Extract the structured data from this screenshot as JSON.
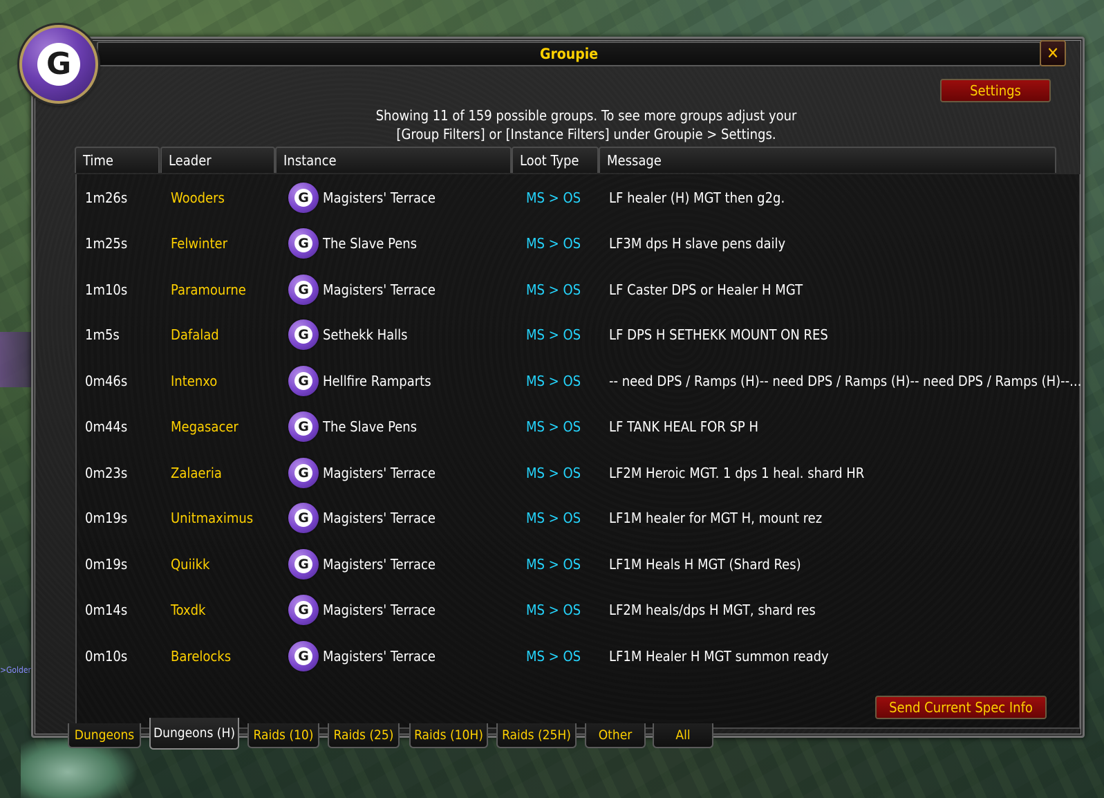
{
  "window": {
    "title": "Groupie",
    "close_glyph": "✕"
  },
  "logo": {
    "letter": "G",
    "icon": "groupie-logo-icon"
  },
  "info": {
    "line1": "Showing 11 of 159 possible groups. To see more groups adjust your",
    "line2": "[Group Filters] or [Instance Filters] under Groupie > Settings."
  },
  "settings_label": "Settings",
  "columns": [
    "Time",
    "Leader",
    "Instance",
    "Loot Type",
    "Message"
  ],
  "rows": [
    {
      "time": "1m26s",
      "leader": "Wooders",
      "instance": "Magisters' Terrace",
      "loot": "MS > OS",
      "message": "LF healer (H) MGT then g2g."
    },
    {
      "time": "1m25s",
      "leader": "Felwinter",
      "instance": "The Slave Pens",
      "loot": "MS > OS",
      "message": "LF3M dps H slave pens daily"
    },
    {
      "time": "1m10s",
      "leader": "Paramourne",
      "instance": "Magisters' Terrace",
      "loot": "MS > OS",
      "message": "LF Caster DPS or Healer H MGT"
    },
    {
      "time": "1m5s",
      "leader": "Dafalad",
      "instance": "Sethekk Halls",
      "loot": "MS > OS",
      "message": "LF DPS H SETHEKK MOUNT ON RES"
    },
    {
      "time": "0m46s",
      "leader": "Intenxo",
      "instance": "Hellfire Ramparts",
      "loot": "MS > OS",
      "message": "-- need DPS / Ramps (H)-- need DPS / Ramps (H)-- need DPS / Ramps (H)--..."
    },
    {
      "time": "0m44s",
      "leader": "Megasacer",
      "instance": "The Slave Pens",
      "loot": "MS > OS",
      "message": "LF TANK HEAL FOR SP H"
    },
    {
      "time": "0m23s",
      "leader": "Zalaeria",
      "instance": "Magisters' Terrace",
      "loot": "MS > OS",
      "message": "LF2M Heroic MGT. 1 dps 1 heal. shard HR"
    },
    {
      "time": "0m19s",
      "leader": "Unitmaximus",
      "instance": "Magisters' Terrace",
      "loot": "MS > OS",
      "message": "LF1M healer for MGT H, mount rez"
    },
    {
      "time": "0m19s",
      "leader": "Quiikk",
      "instance": "Magisters' Terrace",
      "loot": "MS > OS",
      "message": "LF1M Heals H MGT (Shard Res)"
    },
    {
      "time": "0m14s",
      "leader": "Toxdk",
      "instance": "Magisters' Terrace",
      "loot": "MS > OS",
      "message": "LF2M heals/dps H MGT, shard res"
    },
    {
      "time": "0m10s",
      "leader": "Barelocks",
      "instance": "Magisters' Terrace",
      "loot": "MS > OS",
      "message": "LF1M Healer H MGT summon ready"
    }
  ],
  "spec_button": "Send Current Spec Info",
  "tabs": [
    "Dungeons",
    "Dungeons (H)",
    "Raids (10)",
    "Raids (25)",
    "Raids (10H)",
    "Raids (25H)",
    "Other",
    "All"
  ],
  "active_tab": "Dungeons (H)",
  "background_chat": ">Golder",
  "colors": {
    "leader": "#ffd100",
    "loot": "#25d6ff",
    "title": "#ffd100",
    "button_red": "#9a0d0d"
  }
}
